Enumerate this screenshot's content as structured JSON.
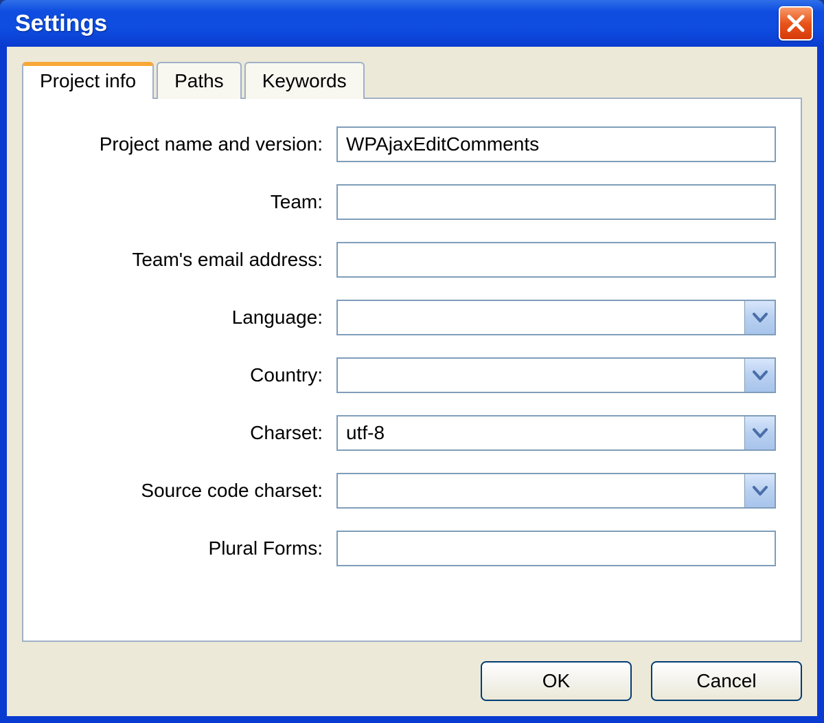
{
  "window": {
    "title": "Settings"
  },
  "tabs": [
    {
      "label": "Project info"
    },
    {
      "label": "Paths"
    },
    {
      "label": "Keywords"
    }
  ],
  "form": {
    "project_name": {
      "label": "Project name and version:",
      "value": "WPAjaxEditComments"
    },
    "team": {
      "label": "Team:",
      "value": ""
    },
    "team_email": {
      "label": "Team's email address:",
      "value": ""
    },
    "language": {
      "label": "Language:",
      "value": ""
    },
    "country": {
      "label": "Country:",
      "value": ""
    },
    "charset": {
      "label": "Charset:",
      "value": "utf-8"
    },
    "source_charset": {
      "label": "Source code charset:",
      "value": ""
    },
    "plural_forms": {
      "label": "Plural Forms:",
      "value": ""
    }
  },
  "buttons": {
    "ok": "OK",
    "cancel": "Cancel"
  }
}
